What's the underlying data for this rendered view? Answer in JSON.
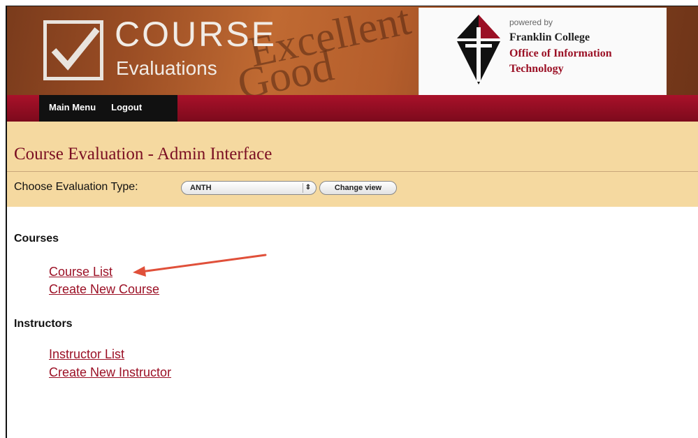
{
  "banner": {
    "bg_words": [
      "Excellent",
      "Good"
    ],
    "logo_title": "COURSE",
    "logo_subtitle": "Evaluations",
    "powered_by": "powered by",
    "college_name": "Franklin College",
    "office_line1": "Office of Information",
    "office_line2": "Technology"
  },
  "nav": {
    "main_menu": "Main Menu",
    "logout": "Logout"
  },
  "admin": {
    "title": "Course Evaluation - Admin Interface",
    "choose_label": "Choose Evaluation Type:",
    "select_value": "ANTH",
    "change_button": "Change view"
  },
  "courses": {
    "heading": "Courses",
    "links": [
      "Course List",
      "Create New Course"
    ]
  },
  "instructors": {
    "heading": "Instructors",
    "links": [
      "Instructor List",
      "Create New Instructor"
    ]
  },
  "colors": {
    "accent": "#9b1025",
    "navbar": "#a9112a",
    "admin_bg": "#f5d9a0",
    "annotation_arrow": "#e0503a"
  }
}
